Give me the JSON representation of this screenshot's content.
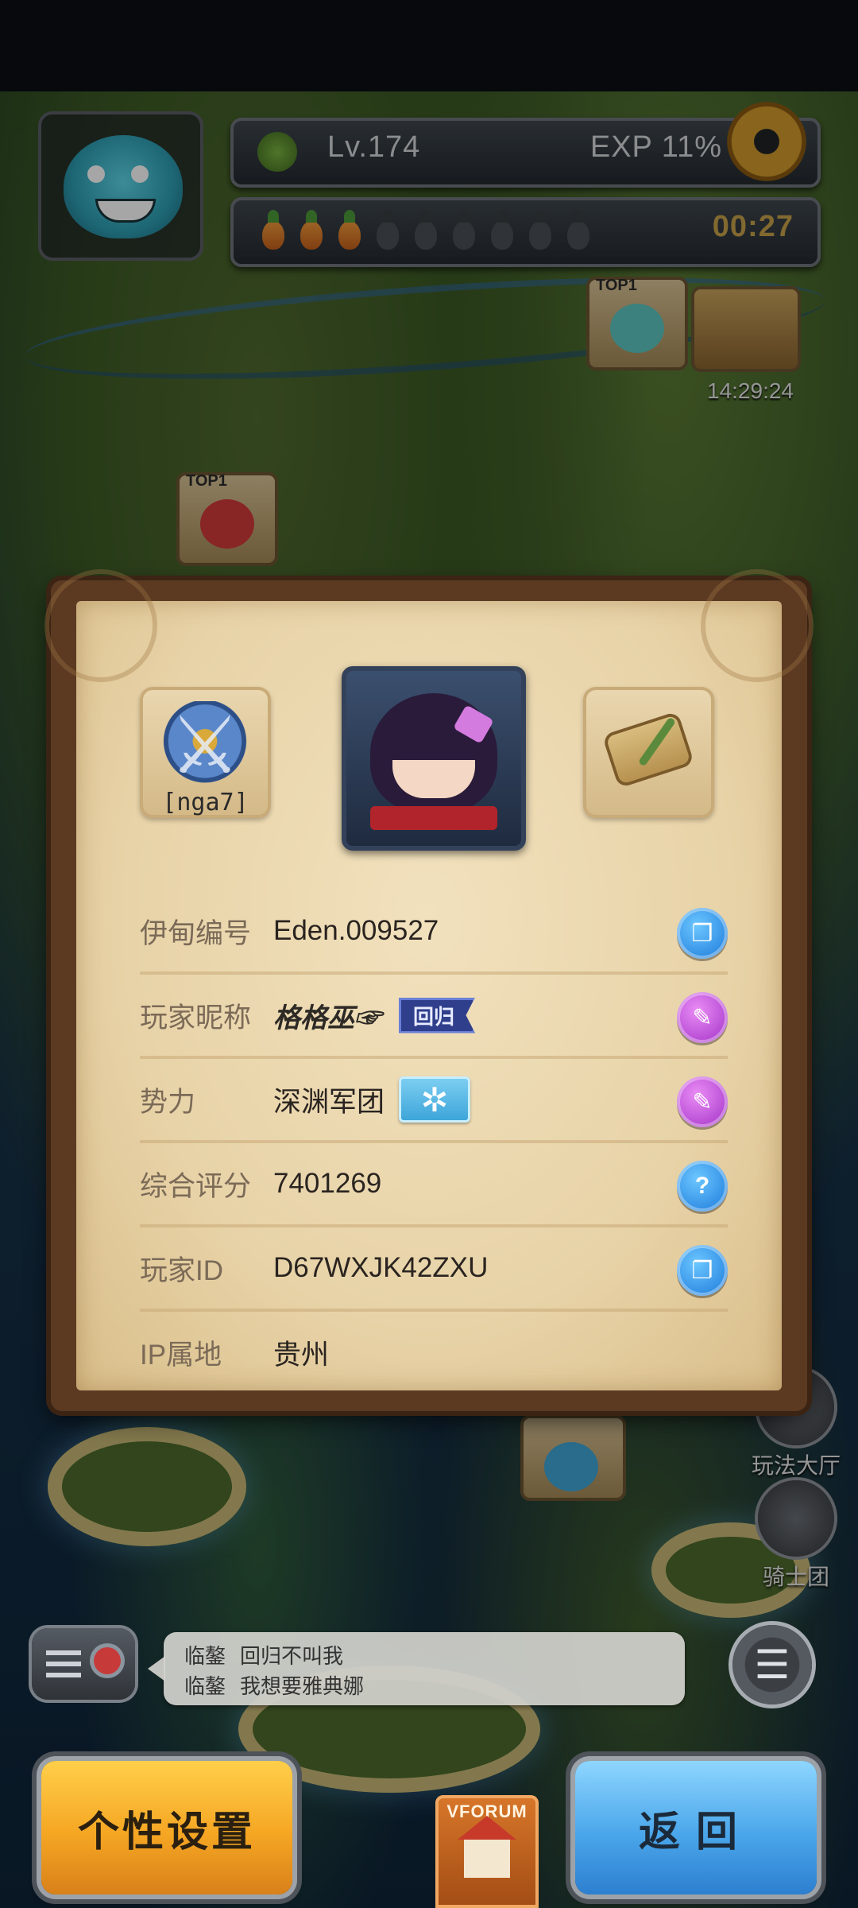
{
  "hud": {
    "level": "Lv.174",
    "exp": "EXP 11%",
    "energy": {
      "filled": 3,
      "total": 9
    },
    "timer": "00:27"
  },
  "map": {
    "badge_label": "TOP1",
    "chest_timer": "14:29:24"
  },
  "profile": {
    "guild_tag": "[nga7]",
    "rows": [
      {
        "label": "伊甸编号",
        "value": "Eden.009527",
        "button": "copy-icon"
      },
      {
        "label": "玩家昵称",
        "value": "格格巫☞",
        "tag": "回归",
        "button": "edit-icon"
      },
      {
        "label": "势力",
        "value": "深渊军团",
        "button": "edit-icon"
      },
      {
        "label": "综合评分",
        "value": "7401269",
        "button": "help-icon"
      },
      {
        "label": "玩家ID",
        "value": "D67WXJK42ZXU",
        "button": "copy-icon"
      },
      {
        "label": "IP属地",
        "value": "贵州"
      }
    ]
  },
  "side_menu": [
    {
      "label": "玩法大厅"
    },
    {
      "label": "骑士团"
    }
  ],
  "chat": {
    "messages": [
      {
        "name": "临鏊",
        "text": "回归不叫我"
      },
      {
        "name": "临鏊",
        "text": "我想要雅典娜"
      }
    ]
  },
  "buttons": {
    "settings_label": "个性设置",
    "back_label": "返回"
  },
  "forum_label": "VFORUM",
  "icons": {
    "copy": "copy-icon",
    "edit": "pencil-icon",
    "help": "question-icon",
    "settings": "gear-icon"
  },
  "colors": {
    "panel_frame": "#5c3a22",
    "parchment": "#f1e1bd",
    "btn_orange": "#f5a623",
    "btn_blue": "#4aa6ea",
    "row_btn_blue": "#1877d9",
    "row_btn_purple": "#a02ec5"
  }
}
